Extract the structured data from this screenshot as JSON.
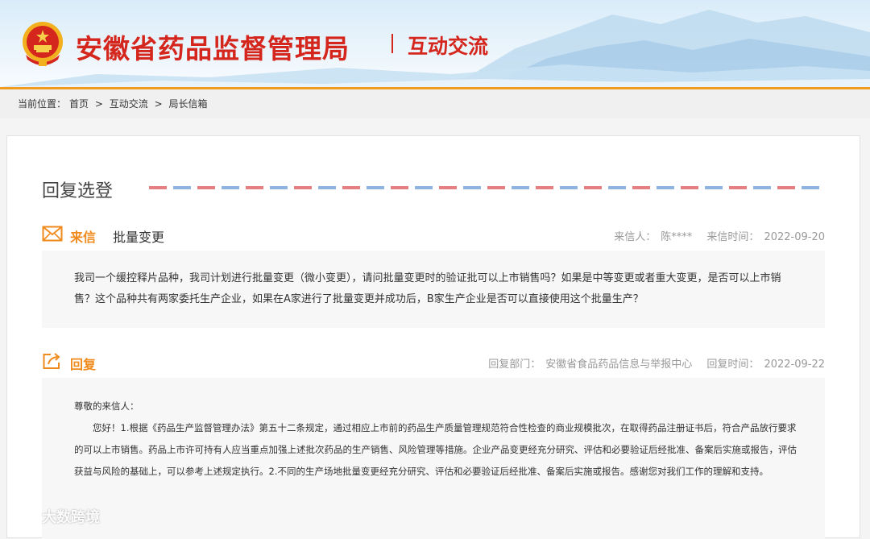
{
  "header": {
    "site_title": "安徽省药品监督管理局",
    "section": "互动交流"
  },
  "breadcrumb": {
    "label": "当前位置：",
    "items": [
      "首页",
      "互动交流",
      "局长信箱"
    ],
    "separator": ">"
  },
  "page": {
    "heading": "回复选登"
  },
  "letter": {
    "label": "来信",
    "subject": "批量变更",
    "sender_label": "来信人：",
    "sender": "陈****",
    "date_label": "来信时间：",
    "date": "2022-09-20",
    "content": "我司一个缓控释片品种，我司计划进行批量变更（微小变更），请问批量变更时的验证批可以上市销售吗？如果是中等变更或者重大变更，是否可以上市销售？这个品种共有两家委托生产企业，如果在A家进行了批量变更并成功后，B家生产企业是否可以直接使用这个批量生产？"
  },
  "reply": {
    "label": "回复",
    "dept_label": "回复部门：",
    "dept": "安徽省食品药品信息与举报中心",
    "date_label": "回复时间：",
    "date": "2022-09-22",
    "greeting": "尊敬的来信人：",
    "body": "您好！1.根据《药品生产监督管理办法》第五十二条规定，通过相应上市前的药品生产质量管理规范符合性检查的商业规模批次，在取得药品注册证书后，符合产品放行要求的可以上市销售。药品上市许可持有人应当重点加强上述批次药品的生产销售、风险管理等措施。企业产品变更经充分研究、评估和必要验证后经批准、备案后实施或报告，评估获益与风险的基础上，可以参考上述规定执行。2.不同的生产场地批量变更经充分研究、评估和必要验证后经批准、备案后实施或报告。感谢您对我们工作的理解和支持。"
  },
  "watermark": {
    "text": "大数跨境"
  },
  "colors": {
    "brand_red": "#d4261c",
    "accent_orange": "#f08a1c",
    "header_line": "#f29c1f",
    "airmail_red": "#e57f7f",
    "airmail_blue": "#8fb3e0"
  }
}
